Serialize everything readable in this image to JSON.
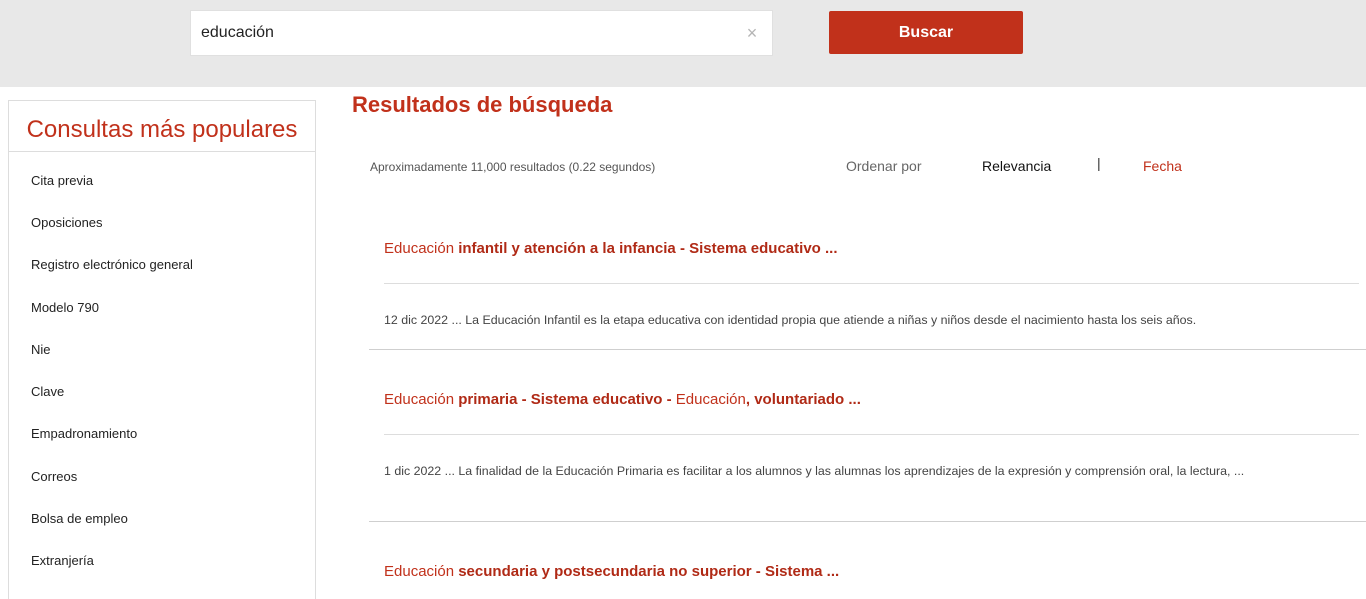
{
  "search": {
    "value": "educación",
    "clear_glyph": "×",
    "button_label": "Buscar"
  },
  "sidebar": {
    "title": "Consultas más populares",
    "items": [
      {
        "label": "Cita previa"
      },
      {
        "label": "Oposiciones"
      },
      {
        "label": "Registro electrónico general"
      },
      {
        "label": "Modelo 790"
      },
      {
        "label": "Nie"
      },
      {
        "label": "Clave"
      },
      {
        "label": "Empadronamiento"
      },
      {
        "label": "Correos"
      },
      {
        "label": "Bolsa de empleo"
      },
      {
        "label": "Extranjería"
      }
    ]
  },
  "results": {
    "title": "Resultados de búsqueda",
    "stats": "Aproximadamente 11,000 resultados (0.22 segundos)",
    "sort": {
      "label": "Ordenar por",
      "relevance": "Relevancia",
      "separator": "|",
      "date": "Fecha"
    },
    "items": [
      {
        "title_prefix": "Educación ",
        "title_bold": "infantil y atención a la infancia - Sistema educativo ...",
        "snippet": "12 dic 2022 ... La Educación Infantil es la etapa educativa con identidad propia que atiende a niñas y niños desde el nacimiento hasta los seis años."
      },
      {
        "title_prefix": "Educación ",
        "title_bold": "primaria - Sistema educativo - ",
        "title_mid": "Educación",
        "title_bold2": ", voluntariado ...",
        "snippet": "1 dic 2022 ... La finalidad de la Educación Primaria es facilitar a los alumnos y las alumnas los aprendizajes de la expresión y comprensión oral, la lectura, ..."
      },
      {
        "title_prefix": "Educación ",
        "title_bold": "secundaria y postsecundaria no superior - Sistema ..."
      }
    ]
  },
  "colors": {
    "accent": "#c1311b",
    "topbar": "#e8e8e8"
  }
}
